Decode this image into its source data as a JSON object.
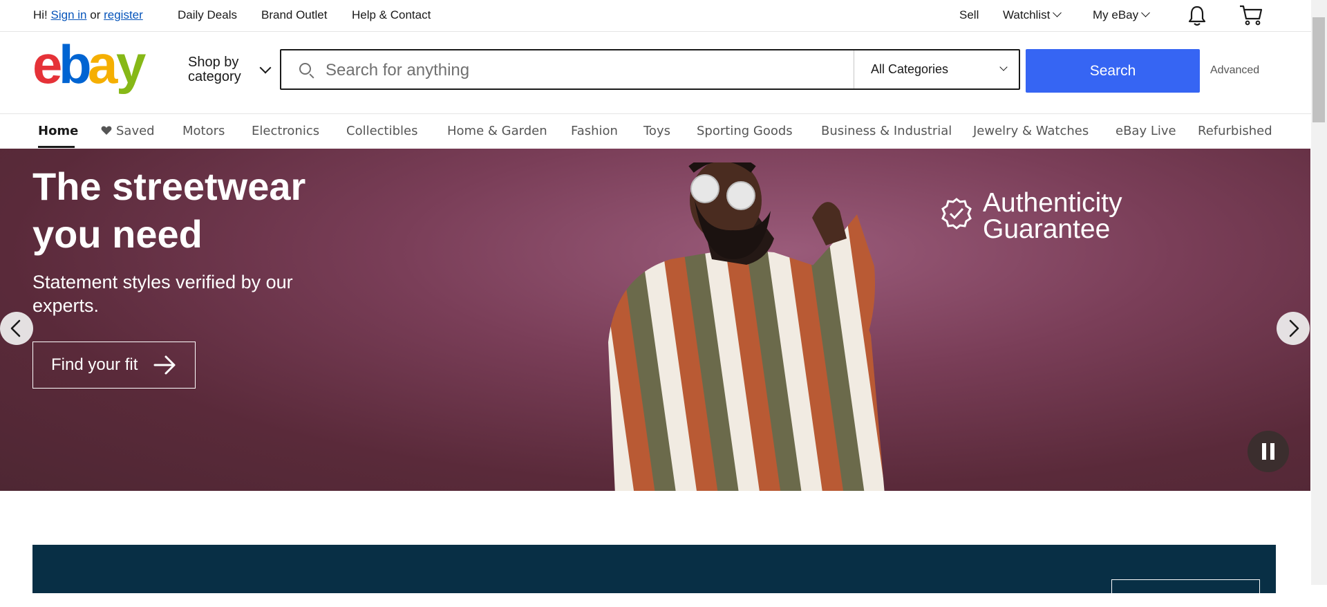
{
  "topbar": {
    "greeting": "Hi!",
    "sign_in": "Sign in",
    "or": "or",
    "register": "register",
    "links": [
      "Daily Deals",
      "Brand Outlet",
      "Help & Contact"
    ],
    "sell": "Sell",
    "watchlist": "Watchlist",
    "my_ebay": "My eBay"
  },
  "header": {
    "logo_letters": [
      "e",
      "b",
      "a",
      "y"
    ],
    "shop_by_line1": "Shop by",
    "shop_by_line2": "category",
    "search_placeholder": "Search for anything",
    "category_selected": "All Categories",
    "search_button": "Search",
    "advanced": "Advanced"
  },
  "nav": {
    "home": "Home",
    "saved": "Saved",
    "items": [
      "Motors",
      "Electronics",
      "Collectibles",
      "Home & Garden",
      "Fashion",
      "Toys",
      "Sporting Goods",
      "Business & Industrial",
      "Jewelry & Watches",
      "eBay Live",
      "Refurbished"
    ]
  },
  "hero": {
    "title": "The streetwear you need",
    "subtitle": "Statement styles verified by our experts.",
    "cta": "Find your fit",
    "badge_line1": "Authenticity",
    "badge_line2": "Guarantee"
  },
  "colors": {
    "brand_blue": "#3665f3",
    "logo_red": "#e53238",
    "logo_blue": "#0064d2",
    "logo_yellow": "#f5af02",
    "logo_green": "#86b817",
    "banner_bg": "#082f45"
  },
  "icons": [
    "chevron-down-icon",
    "bell-icon",
    "cart-icon",
    "search-icon",
    "heart-icon",
    "arrow-right-icon",
    "chevron-left-icon",
    "chevron-right-icon",
    "pause-icon",
    "check-badge-icon"
  ]
}
